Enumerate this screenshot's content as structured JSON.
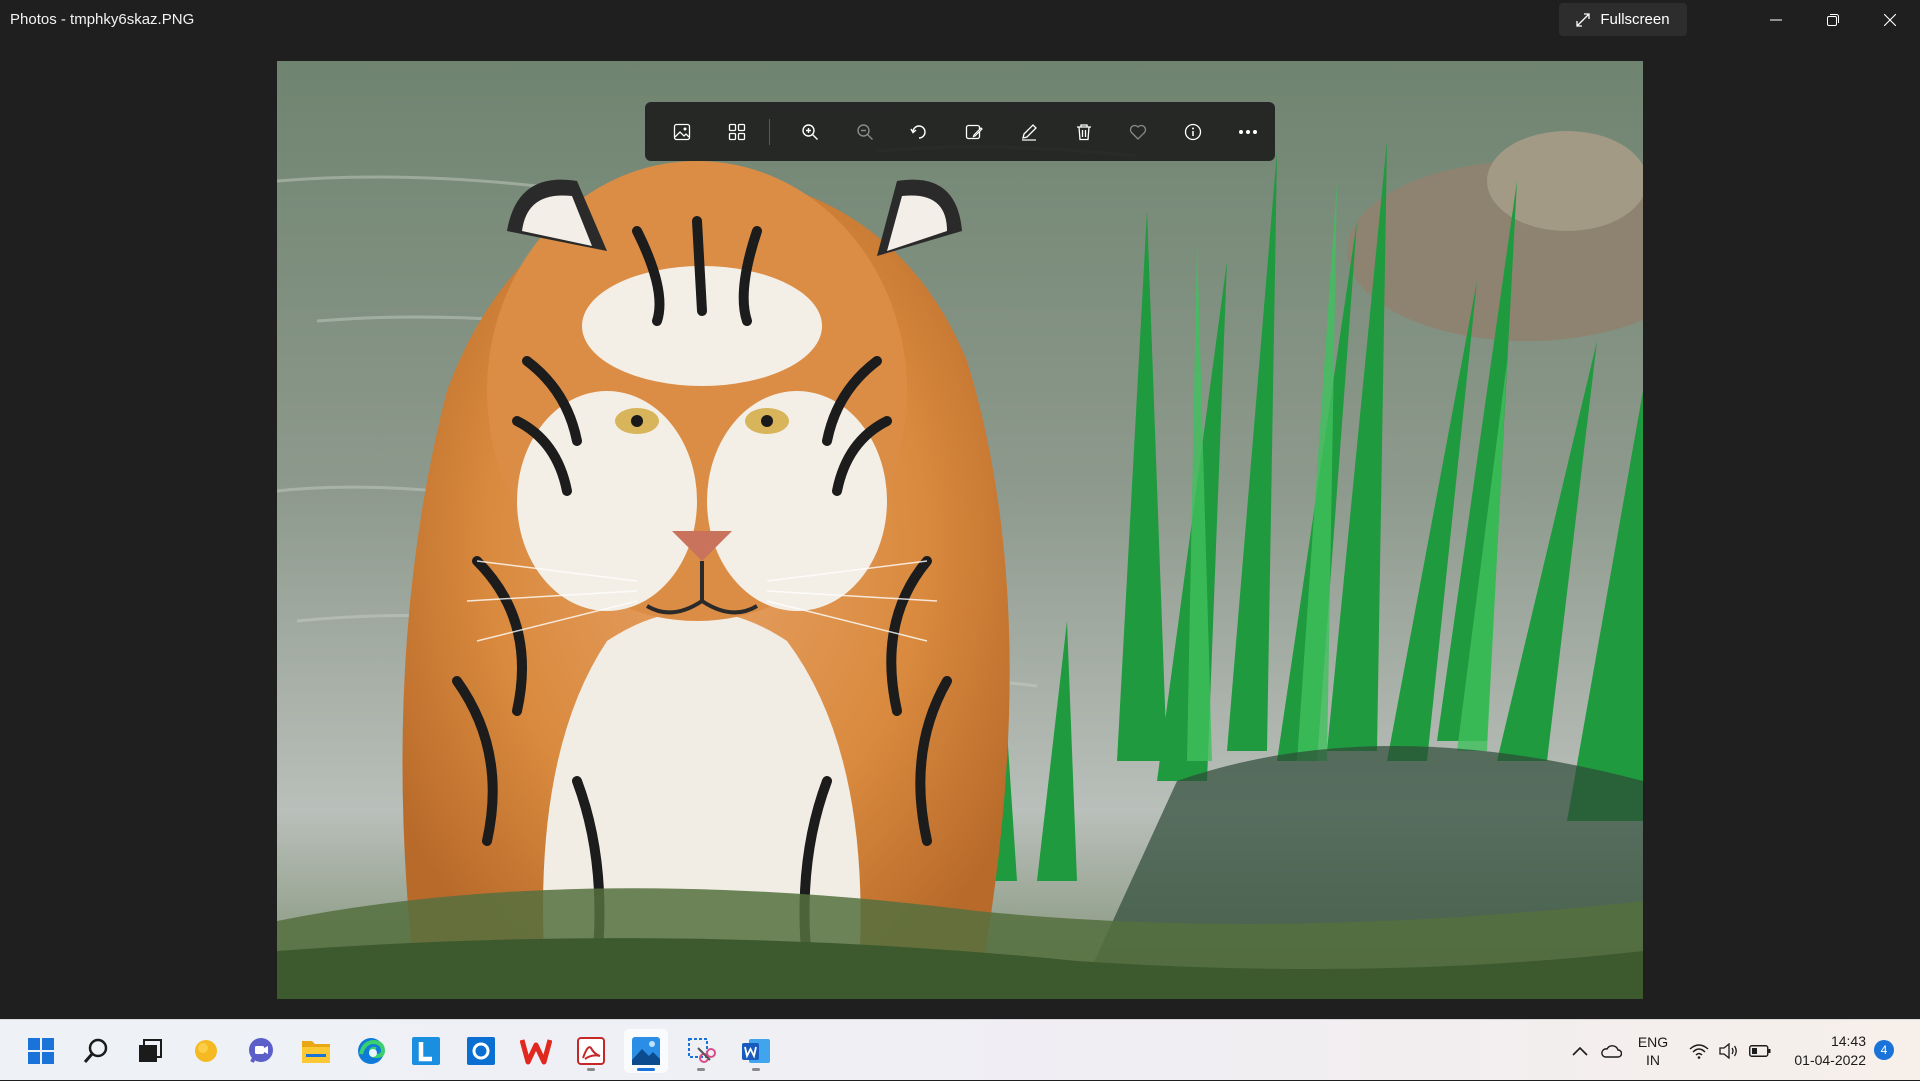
{
  "window": {
    "title": "Photos - tmphky6skaz.PNG",
    "fullscreen_label": "Fullscreen"
  },
  "toolbar": {
    "buttons": [
      "image-icon",
      "collection-icon",
      "zoom-in-icon",
      "zoom-out-icon",
      "rotate-icon",
      "edit-image-icon",
      "draw-icon",
      "delete-icon",
      "favorite-icon",
      "info-icon",
      "more-icon"
    ]
  },
  "photo": {
    "subject": "tiger"
  },
  "taskbar": {
    "apps": [
      "windows-start-icon",
      "search-icon",
      "task-view-icon",
      "widgets-icon",
      "teams-chat-icon",
      "file-explorer-icon",
      "edge-icon",
      "l-app-icon",
      "outlook-icon",
      "wps-office-icon",
      "pdf-app-icon",
      "photos-icon",
      "snipping-tool-icon",
      "word-icon"
    ],
    "lang_line1": "ENG",
    "lang_line2": "IN",
    "time": "14:43",
    "date": "01-04-2022",
    "notification_count": "4"
  },
  "colors": {
    "accent": "#1a73d9",
    "titlebar_bg": "#1f1f1f"
  }
}
